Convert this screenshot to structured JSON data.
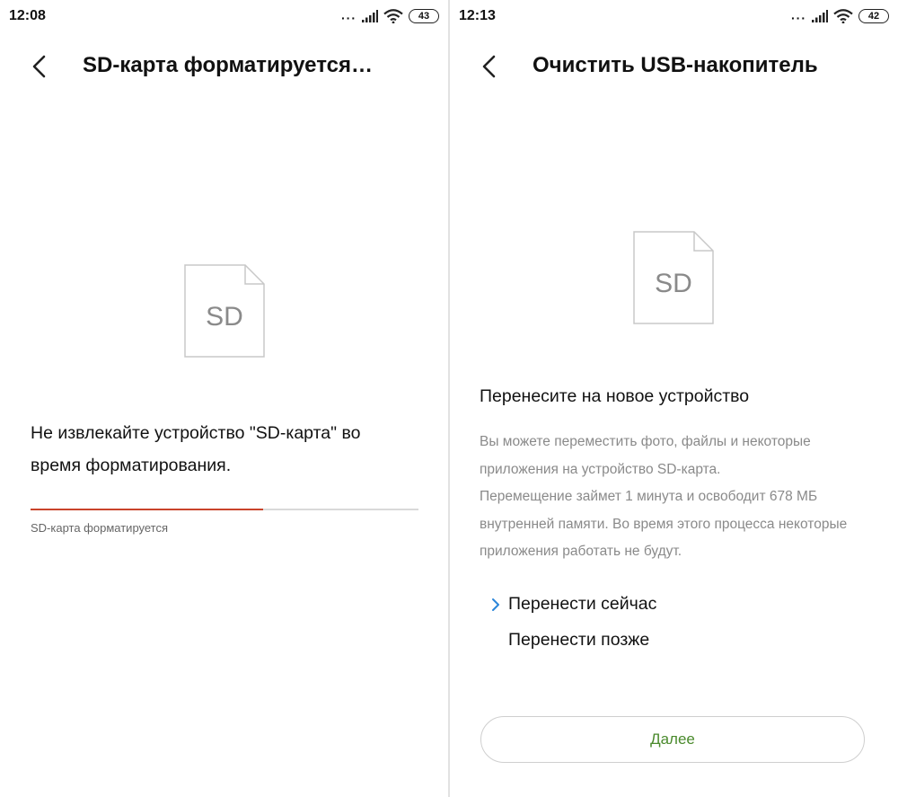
{
  "left_screen": {
    "status_bar": {
      "time": "12:08",
      "battery": "43"
    },
    "header": {
      "title": "SD-карта форматируется…"
    },
    "sd_icon_label": "SD",
    "warning_text": "Не извлекайте устройство \"SD-карта\" во время форматирования.",
    "progress": {
      "fraction": 0.6,
      "status": "SD-карта форматируется",
      "color": "#c9442b"
    }
  },
  "right_screen": {
    "status_bar": {
      "time": "12:13",
      "battery": "42"
    },
    "header": {
      "title": "Очистить USB-накопитель"
    },
    "sd_icon_label": "SD",
    "section_title": "Перенесите на новое устройство",
    "description": [
      "Вы можете переместить фото, файлы и некоторые приложения на устройство SD-карта.",
      "Перемещение займет 1 минута и освободит 678 МБ внутренней памяти. Во время этого процесса некоторые приложения работать не будут."
    ],
    "options": [
      {
        "label": "Перенести сейчас",
        "selected": true
      },
      {
        "label": "Перенести позже",
        "selected": false
      }
    ],
    "next_button": "Далее"
  },
  "icons": {
    "back": "chevron-left-icon",
    "signal": "signal-icon",
    "wifi": "wifi-icon",
    "battery": "battery-icon",
    "sd_card": "sd-card-icon",
    "option_selected": "chevron-right-icon"
  },
  "colors": {
    "progress_accent": "#c9442b",
    "option_chevron": "#2b86d9",
    "next_button_text": "#4a8a2c",
    "secondary_text": "#8a8a8a"
  }
}
